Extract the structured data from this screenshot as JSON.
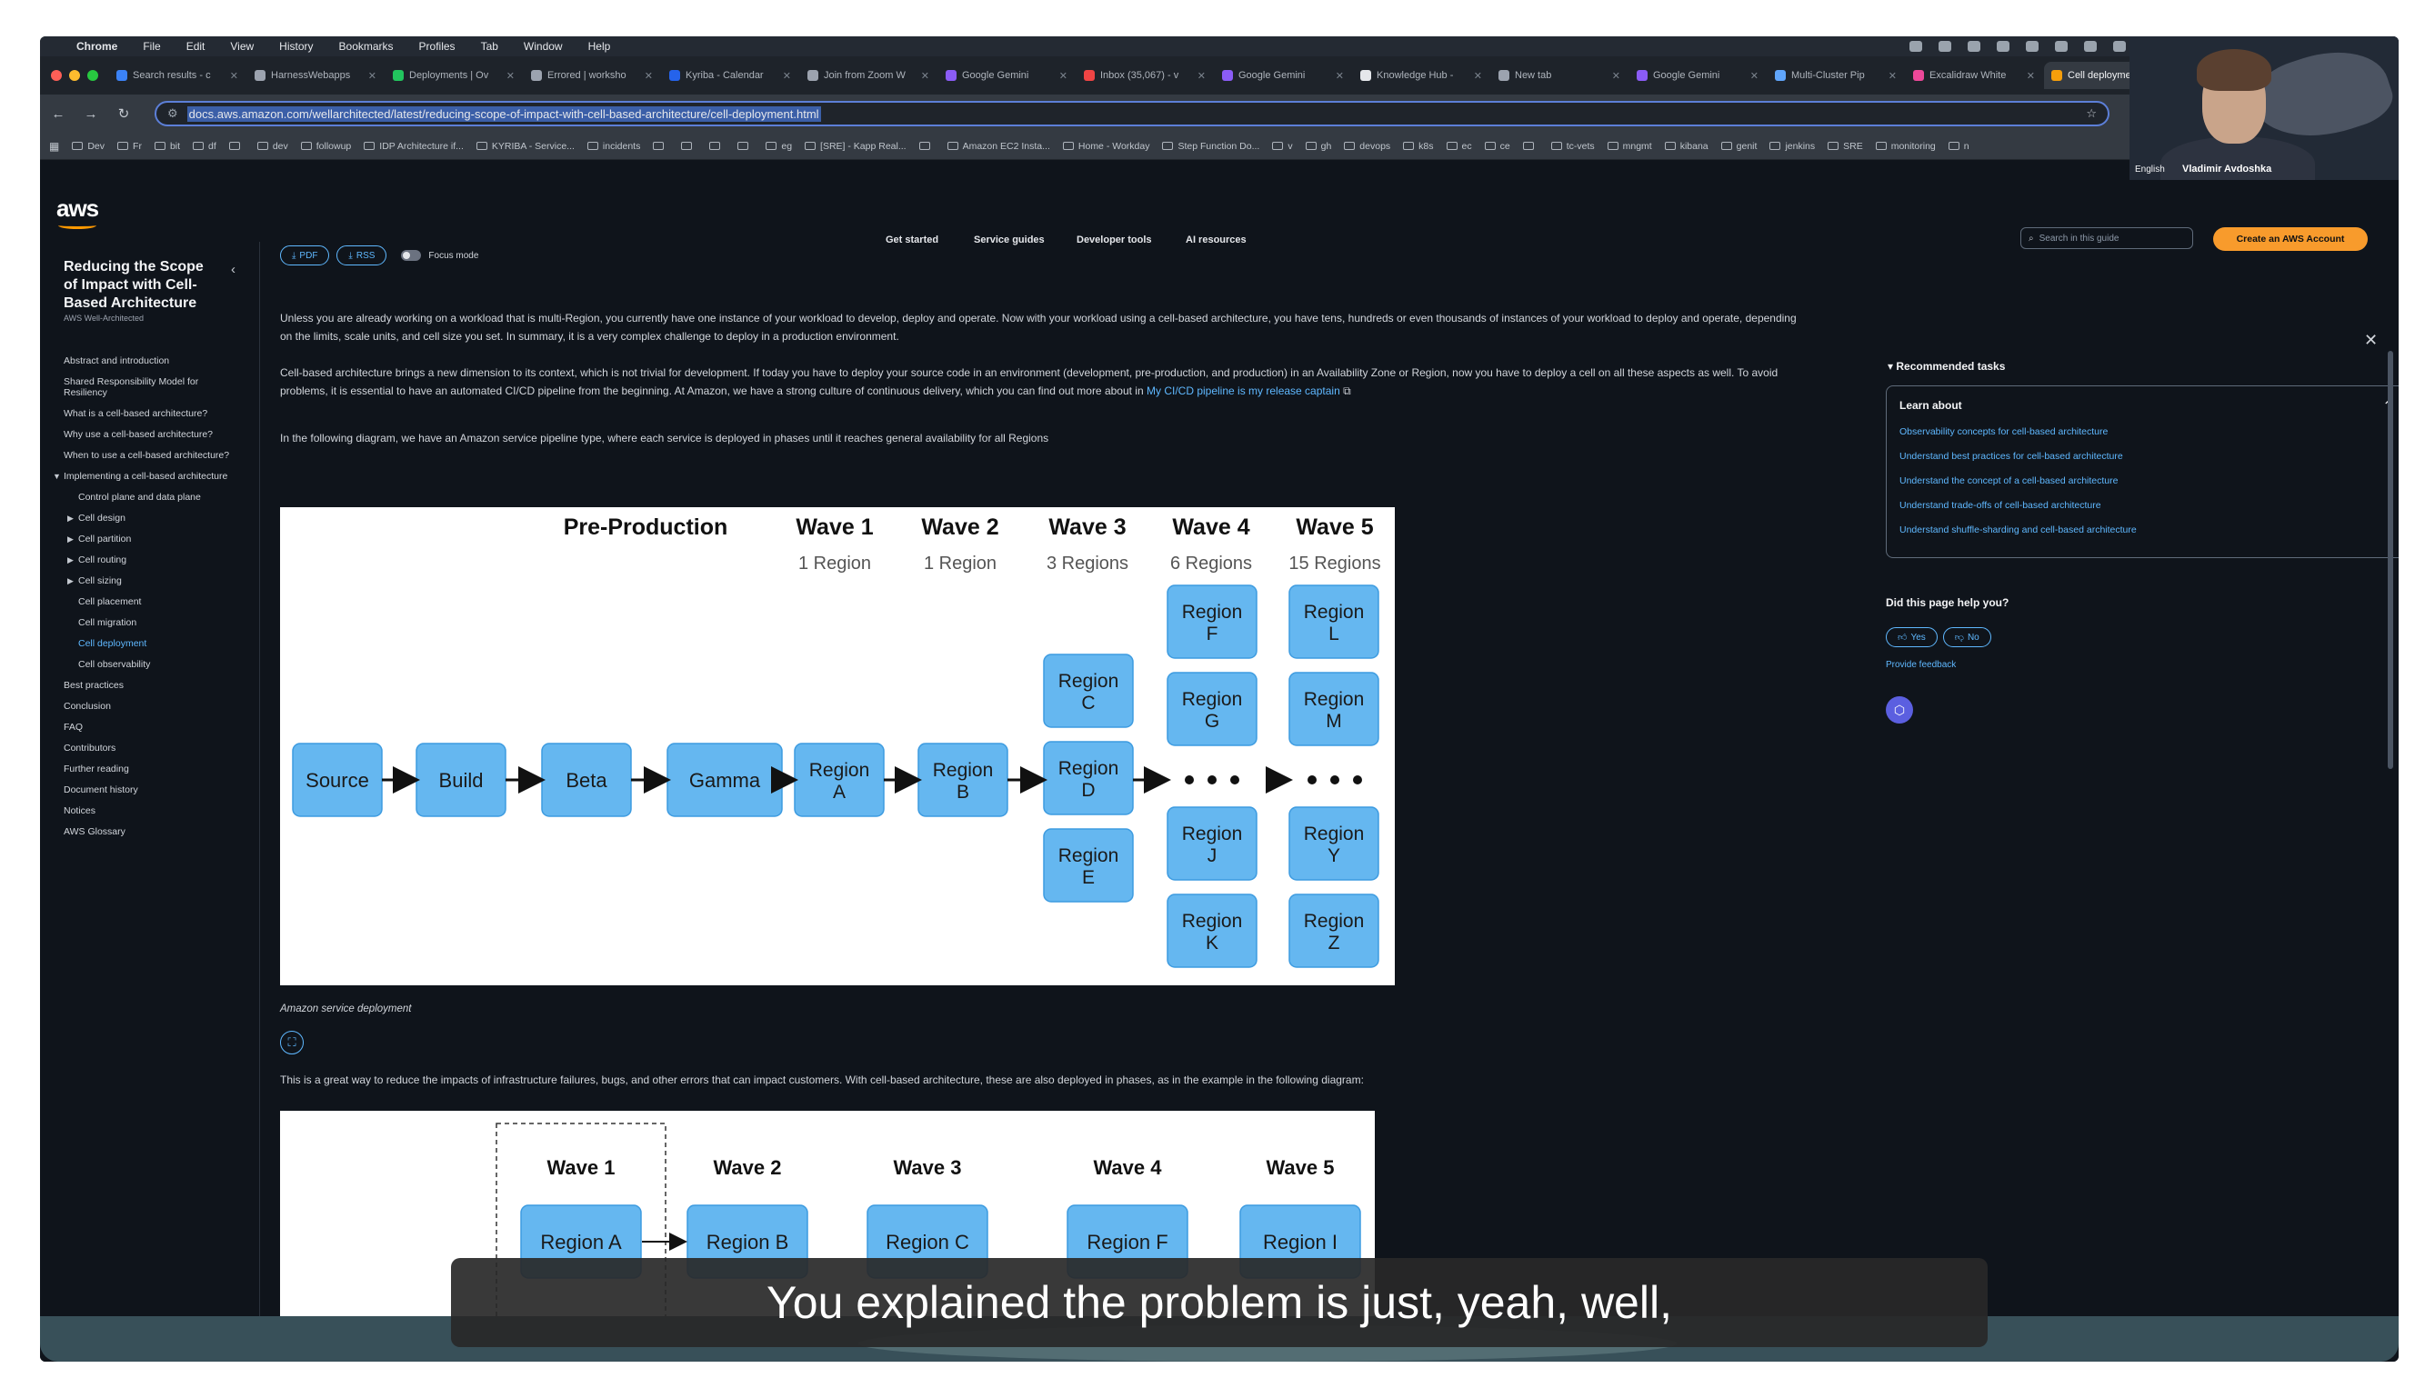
{
  "menubar": {
    "items": [
      "Chrome",
      "File",
      "Edit",
      "View",
      "History",
      "Bookmarks",
      "Profiles",
      "Tab",
      "Window",
      "Help"
    ]
  },
  "tabs": [
    {
      "title": "Search results - c",
      "color": "#3b82f6"
    },
    {
      "title": "HarnessWebapps",
      "color": "#9ca3af"
    },
    {
      "title": "Deployments | Ov",
      "color": "#22c55e"
    },
    {
      "title": "Errored | worksho",
      "color": "#9ca3af"
    },
    {
      "title": "Kyriba - Calendar",
      "color": "#2563eb"
    },
    {
      "title": "Join from Zoom W",
      "color": "#9ca3af"
    },
    {
      "title": "Google Gemini",
      "color": "#8b5cf6"
    },
    {
      "title": "Inbox (35,067) - v",
      "color": "#ef4444"
    },
    {
      "title": "Google Gemini",
      "color": "#8b5cf6"
    },
    {
      "title": "Knowledge Hub -",
      "color": "#e5e7eb"
    },
    {
      "title": "New tab",
      "color": "#9ca3af"
    },
    {
      "title": "Google Gemini",
      "color": "#8b5cf6"
    },
    {
      "title": "Multi-Cluster Pip",
      "color": "#60a5fa"
    },
    {
      "title": "Excalidraw White",
      "color": "#ec4899"
    },
    {
      "title": "Cell deployment",
      "color": "#f59e0b",
      "active": true
    }
  ],
  "address": {
    "url": "docs.aws.amazon.com/wellarchitected/latest/reducing-scope-of-impact-with-cell-based-architecture/cell-deployment.html"
  },
  "bookmarks": [
    "Dev",
    "Fr",
    "bit",
    "df",
    "",
    "dev",
    "followup",
    "IDP Architecture if...",
    "KYRIBA - Service...",
    "incidents",
    "",
    "",
    "",
    "",
    "eg",
    "[SRE] - Kapp Real...",
    "",
    "Amazon EC2 Insta...",
    "Home - Workday",
    "Step Function Do...",
    "v",
    "gh",
    "devops",
    "k8s",
    "ec",
    "ce",
    "",
    "tc-vets",
    "mngmt",
    "kibana",
    "genit",
    "jenkins",
    "SRE",
    "monitoring",
    "n"
  ],
  "webcam": {
    "lang": "English",
    "name": "Vladimir Avdoshka"
  },
  "aws": {
    "logo": "aws",
    "nav": [
      "Get started",
      "Service guides",
      "Developer tools",
      "AI resources"
    ],
    "search_placeholder": "Search in this guide",
    "create_account": "Create an AWS Account"
  },
  "sidebar": {
    "title": "Reducing the Scope of Impact with Cell-Based Architecture",
    "subtitle": "AWS Well-Architected",
    "items": [
      {
        "label": "Abstract and introduction",
        "level": 0
      },
      {
        "label": "Shared Responsibility Model for Resiliency",
        "level": 0
      },
      {
        "label": "What is a cell-based architecture?",
        "level": 0
      },
      {
        "label": "Why use a cell-based architecture?",
        "level": 0
      },
      {
        "label": "When to use a cell-based architecture?",
        "level": 0
      },
      {
        "label": "Implementing a cell-based architecture",
        "level": 0,
        "caret": "▼"
      },
      {
        "label": "Control plane and data plane",
        "level": 1
      },
      {
        "label": "Cell design",
        "level": 1,
        "caret": "▶"
      },
      {
        "label": "Cell partition",
        "level": 1,
        "caret": "▶"
      },
      {
        "label": "Cell routing",
        "level": 1,
        "caret": "▶"
      },
      {
        "label": "Cell sizing",
        "level": 1,
        "caret": "▶"
      },
      {
        "label": "Cell placement",
        "level": 1
      },
      {
        "label": "Cell migration",
        "level": 1
      },
      {
        "label": "Cell deployment",
        "level": 1,
        "active": true
      },
      {
        "label": "Cell observability",
        "level": 1
      },
      {
        "label": "Best practices",
        "level": 0
      },
      {
        "label": "Conclusion",
        "level": 0
      },
      {
        "label": "FAQ",
        "level": 0
      },
      {
        "label": "Contributors",
        "level": 0
      },
      {
        "label": "Further reading",
        "level": 0
      },
      {
        "label": "Document history",
        "level": 0
      },
      {
        "label": "Notices",
        "level": 0
      },
      {
        "label": "AWS Glossary",
        "level": 0
      }
    ]
  },
  "content": {
    "pdf": "PDF",
    "rss": "RSS",
    "focus_mode": "Focus mode",
    "p1": "Unless you are already working on a workload that is multi-Region, you currently have one instance of your workload to develop, deploy and operate. Now with your workload using a cell-based architecture, you have tens, hundreds or even thousands of instances of your workload to deploy and operate, depending on the limits, scale units, and cell size you set. In summary, it is a very complex challenge to deploy in a production environment.",
    "p2": "Cell-based architecture brings a new dimension to its context, which is not trivial for development. If today you have to deploy your source code in an environment (development, pre-production, and production) in an Availability Zone or Region, now you have to deploy a cell on all these aspects as well. To avoid problems, it is essential to have an automated CI/CD pipeline from the beginning. At Amazon, we have a strong culture of continuous delivery, which you can find out more about in",
    "p2_link": "My CI/CD pipeline is my release captain",
    "p3": "In the following diagram, we have an Amazon service pipeline type, where each service is deployed in phases until it reaches general availability for all Regions",
    "fig1_caption": "Amazon service deployment",
    "p4": "This is a great way to reduce the impacts of infrastructure failures, bugs, and other errors that can impact customers. With cell-based architecture, these are also deployed in phases, as in the example in the following diagram:"
  },
  "fig1": {
    "headers": [
      {
        "title": "Pre-Production",
        "sub": ""
      },
      {
        "title": "Wave 1",
        "sub": "1 Region"
      },
      {
        "title": "Wave 2",
        "sub": "1 Region"
      },
      {
        "title": "Wave 3",
        "sub": "3 Regions"
      },
      {
        "title": "Wave 4",
        "sub": "6 Regions"
      },
      {
        "title": "Wave 5",
        "sub": "15 Regions"
      }
    ],
    "pipeline": [
      "Source",
      "Build",
      "Beta",
      "Gamma"
    ],
    "region_a": "Region A",
    "region_b": "Region B",
    "wave3": [
      "Region C",
      "Region D",
      "Region E"
    ],
    "wave4_top": [
      "Region F",
      "Region G"
    ],
    "wave4_bottom": [
      "Region J",
      "Region K"
    ],
    "wave5_top": [
      "Region L",
      "Region M"
    ],
    "wave5_bottom": [
      "Region Y",
      "Region Z"
    ],
    "box_color": "#65b7f0",
    "box_border": "#3d9be0"
  },
  "fig2": {
    "waves": [
      "Wave 1",
      "Wave 2",
      "Wave 3",
      "Wave 4",
      "Wave 5"
    ],
    "regions": [
      "Region A",
      "Region B",
      "Region C",
      "Region F",
      "Region I"
    ]
  },
  "right_panel": {
    "title": "Recommended tasks",
    "learn_about": "Learn about",
    "links": [
      "Observability concepts for cell-based architecture",
      "Understand best practices for cell-based architecture",
      "Understand the concept of a cell-based architecture",
      "Understand trade-offs of cell-based architecture",
      "Understand shuffle-sharding and cell-based architecture"
    ],
    "help_q": "Did this page help you?",
    "yes": "Yes",
    "no": "No",
    "feedback": "Provide feedback"
  },
  "caption": "You explained the problem is just, yeah, well,"
}
